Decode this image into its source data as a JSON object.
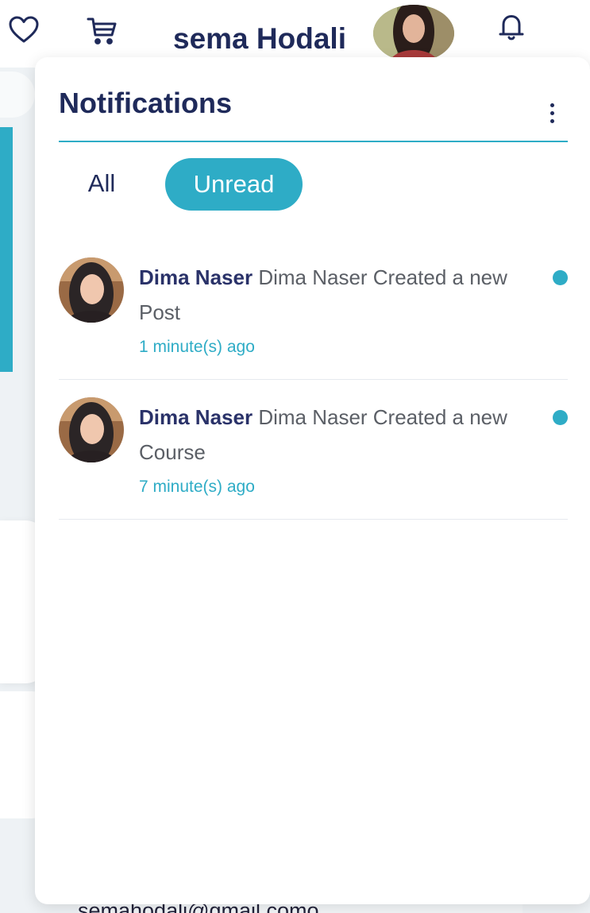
{
  "header": {
    "username": "sema Hodali",
    "icons": [
      "heart-icon",
      "cart-icon",
      "bell-icon"
    ]
  },
  "notifications": {
    "title": "Notifications",
    "tabs": [
      {
        "label": "All",
        "active": false
      },
      {
        "label": "Unread",
        "active": true
      }
    ],
    "items": [
      {
        "author": "Dima Naser",
        "message": "Dima Naser Created a new Post",
        "time": "1 minute(s) ago",
        "unread": true
      },
      {
        "author": "Dima Naser",
        "message": "Dima Naser Created a new Course",
        "time": "7 minute(s) ago",
        "unread": true
      }
    ]
  },
  "background": {
    "email": "semahodali@gmail.como"
  },
  "colors": {
    "accent": "#2eacc6",
    "navy": "#1f2a5a",
    "muted_text": "#5b5f66",
    "divider": "#e6e9ee",
    "page_bg": "#eef2f5"
  }
}
